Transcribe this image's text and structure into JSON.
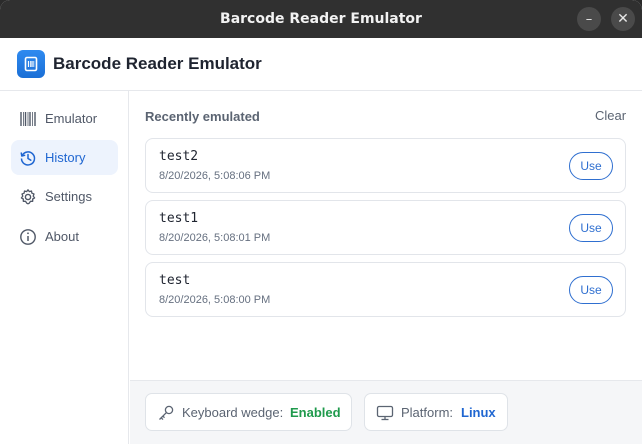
{
  "window": {
    "title": "Barcode Reader Emulator",
    "minimize_glyph": "–",
    "close_glyph": "✕"
  },
  "header": {
    "app_title": "Barcode Reader Emulator",
    "logo_icon": "barcode-reader-icon",
    "accent_color": "#1a6fd6"
  },
  "sidebar": {
    "items": [
      {
        "label": "Emulator",
        "icon": "barcode-icon",
        "active": false
      },
      {
        "label": "History",
        "icon": "history-icon",
        "active": true
      },
      {
        "label": "Settings",
        "icon": "gear-icon",
        "active": false
      },
      {
        "label": "About",
        "icon": "info-icon",
        "active": false
      }
    ]
  },
  "main": {
    "section_title": "Recently emulated",
    "clear_label": "Clear",
    "history": [
      {
        "code": "test2",
        "timestamp": "8/20/2026, 5:08:06 PM",
        "action": "Use"
      },
      {
        "code": "test1",
        "timestamp": "8/20/2026, 5:08:01 PM",
        "action": "Use"
      },
      {
        "code": "test",
        "timestamp": "8/20/2026, 5:08:00 PM",
        "action": "Use"
      }
    ]
  },
  "footer": {
    "keyboard_wedge": {
      "label": "Keyboard wedge:",
      "value": "Enabled",
      "icon": "key-icon",
      "color": "#1f9a4c"
    },
    "platform": {
      "label": "Platform:",
      "value": "Linux",
      "icon": "monitor-icon",
      "color": "#1f66d1"
    }
  }
}
